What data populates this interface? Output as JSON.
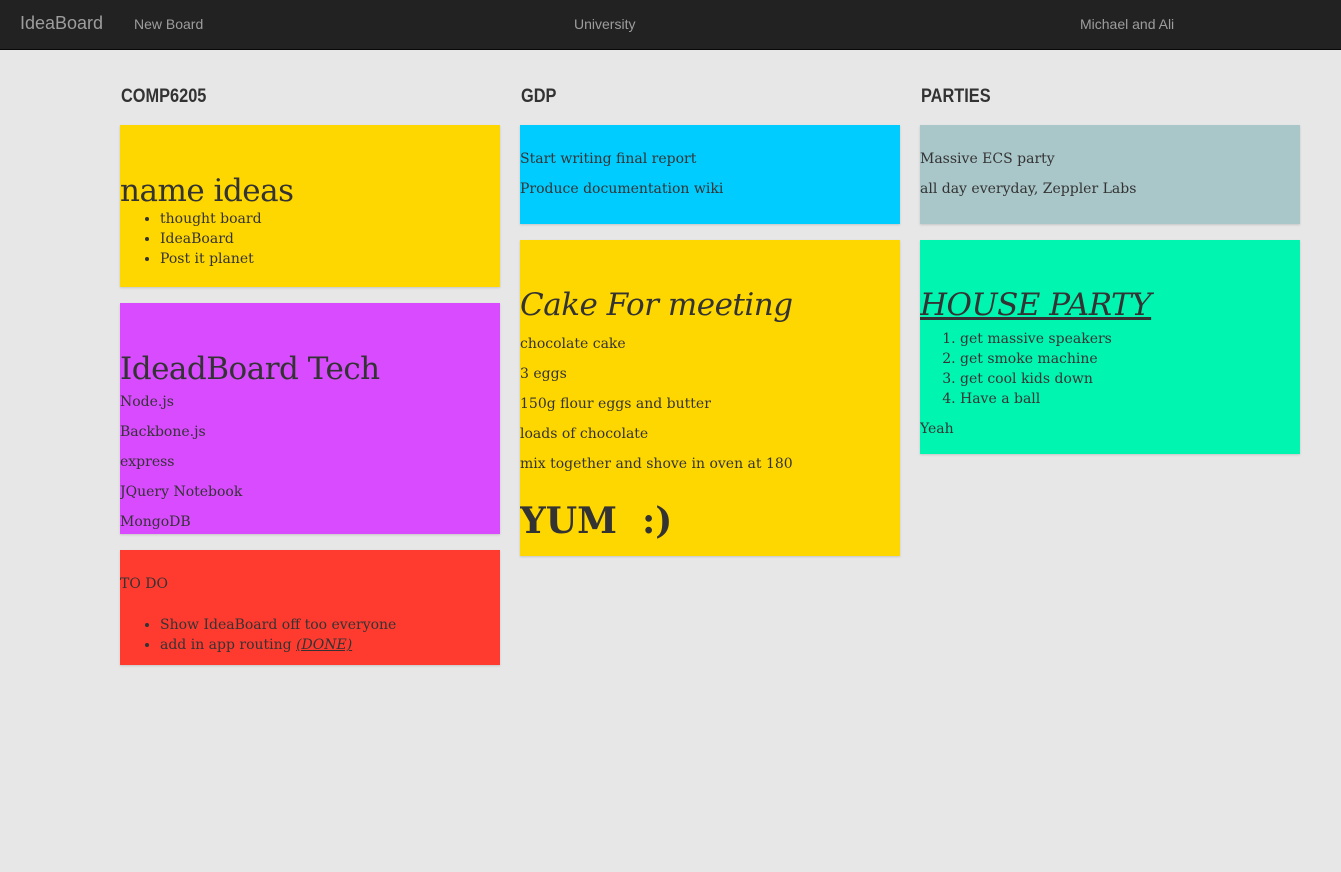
{
  "navbar": {
    "brand": "IdeaBoard",
    "new_board": "New Board",
    "current_board": "University",
    "users": "Michael and Ali"
  },
  "columns": [
    {
      "title": "COMP6205",
      "notes": [
        {
          "color": "#ffd700",
          "heading": "name ideas",
          "items": [
            "thought board",
            "IdeaBoard",
            "Post it planet"
          ]
        },
        {
          "color": "#d94bff",
          "heading": "IdeadBoard Tech",
          "lines": [
            "Node.js",
            "Backbone.js",
            "express",
            "JQuery Notebook",
            "MongoDB"
          ]
        },
        {
          "color": "#ff3b30",
          "heading": "TO DO",
          "items": [
            "Show IdeaBoard off too everyone",
            "add in app routing"
          ],
          "done_tag": "(DONE)"
        }
      ]
    },
    {
      "title": "GDP",
      "notes": [
        {
          "color": "#00ccff",
          "lines": [
            "Start writing final report",
            "Produce documentation wiki"
          ]
        },
        {
          "color": "#ffd700",
          "heading": "Cake For meeting",
          "lines": [
            "chocolate cake",
            "3 eggs",
            "150g flour eggs and butter",
            "loads of chocolate",
            "mix together and shove in oven at 180"
          ],
          "footer": "YUM  :)"
        }
      ]
    },
    {
      "title": "PARTIES",
      "notes": [
        {
          "color": "#a9c6c9",
          "lines": [
            "Massive ECS party",
            "all day everyday, Zeppler Labs"
          ]
        },
        {
          "color": "#00f5b0",
          "heading": "HOUSE PARTY",
          "items": [
            "get massive speakers",
            "get smoke machine",
            "get cool kids down",
            "Have a ball"
          ],
          "footer": "Yeah"
        }
      ]
    }
  ]
}
